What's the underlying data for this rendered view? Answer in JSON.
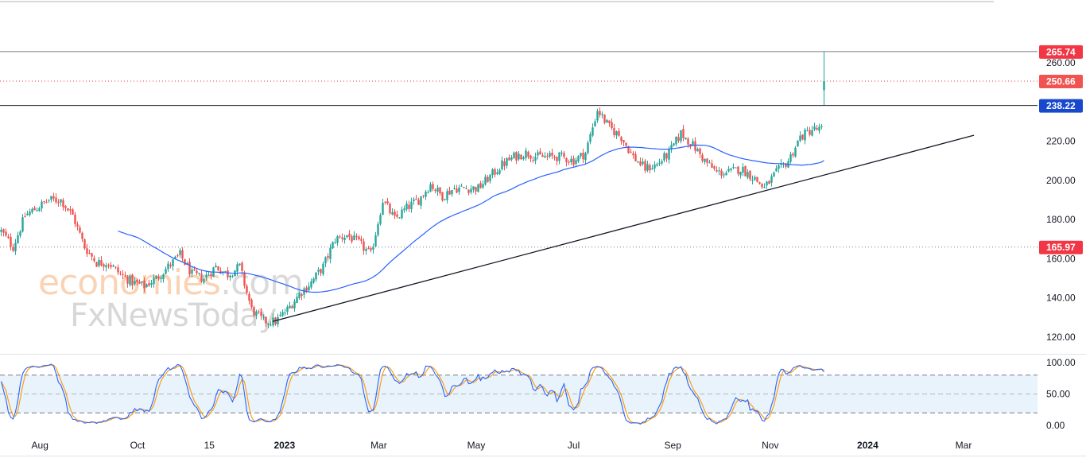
{
  "chart_data": {
    "type": "candlestick",
    "title": "",
    "start_date": "2022-07-07",
    "weekly_closes": [
      174,
      166,
      182,
      186,
      190,
      190,
      182,
      166,
      158,
      158,
      152,
      148,
      146,
      150,
      156,
      162,
      152,
      150,
      156,
      152,
      156,
      134,
      128,
      128,
      134,
      142,
      148,
      156,
      170,
      172,
      168,
      162,
      190,
      180,
      186,
      190,
      198,
      192,
      196,
      196,
      196,
      202,
      208,
      212,
      214,
      212,
      212,
      212,
      210,
      214,
      236,
      227,
      222,
      212,
      206,
      208,
      214,
      224,
      218,
      210,
      204,
      204,
      206,
      202,
      196,
      204,
      210,
      222,
      226
    ],
    "last_candle": {
      "open": 246,
      "high": 265.74,
      "low": 238.5,
      "close": 250.66
    },
    "moving_average": {
      "period": 50,
      "color": "#2962ff"
    },
    "trendline": {
      "from": [
        128,
        "2022-12-29"
      ],
      "to": [
        223,
        "2024-02-24"
      ]
    },
    "ylim": [
      112,
      276
    ],
    "y_ticks": [
      "260.00",
      "220.00",
      "200.00",
      "180.00",
      "160.00",
      "140.00",
      "120.00"
    ],
    "y_tick_values": [
      260,
      220,
      200,
      180,
      160,
      140,
      120
    ],
    "price_levels": [
      {
        "label": "265.74",
        "value": 265.74,
        "color": "#f23645",
        "style": "solid-grey"
      },
      {
        "label": "250.66",
        "value": 250.66,
        "color": "#f05350",
        "style": "dotted-red"
      },
      {
        "label": "238.22",
        "value": 238.22,
        "color": "#1848cc",
        "style": "solid-black"
      },
      {
        "label": "165.97",
        "value": 165.97,
        "color": "#f23645",
        "style": "dotted-grey"
      }
    ],
    "x_ticks": [
      {
        "label": "Aug",
        "date": "2022-08-01",
        "bold": false
      },
      {
        "label": "Oct",
        "date": "2022-10-01",
        "bold": false
      },
      {
        "label": "15",
        "date": "2022-11-15",
        "bold": false
      },
      {
        "label": "2023",
        "date": "2023-01-01",
        "bold": true
      },
      {
        "label": "Mar",
        "date": "2023-03-01",
        "bold": false
      },
      {
        "label": "May",
        "date": "2023-05-01",
        "bold": false
      },
      {
        "label": "Jul",
        "date": "2023-07-01",
        "bold": false
      },
      {
        "label": "Sep",
        "date": "2023-09-01",
        "bold": false
      },
      {
        "label": "Nov",
        "date": "2023-11-01",
        "bold": false
      },
      {
        "label": "2024",
        "date": "2024-01-01",
        "bold": true
      },
      {
        "label": "Mar",
        "date": "2024-03-01",
        "bold": false
      }
    ],
    "stochastic": {
      "k_period": 14,
      "smooth": 3,
      "k_color": "#2962ff",
      "d_color": "#ff9800",
      "band": [
        20,
        80
      ],
      "y_ticks": [
        "100.00",
        "50.00",
        "0.00"
      ],
      "y_tick_values": [
        100,
        50,
        0
      ]
    },
    "colors": {
      "up": "#26a69a",
      "down": "#ef5350"
    }
  },
  "watermark": {
    "brand1": "economies",
    "brand1_suffix": ".com",
    "brand2": "FxNewsToday"
  }
}
